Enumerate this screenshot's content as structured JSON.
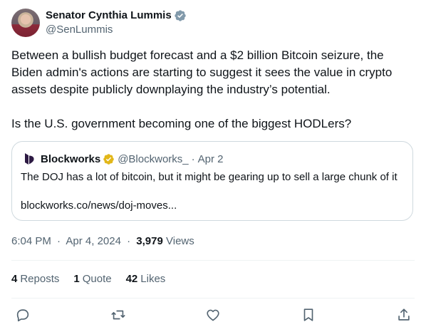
{
  "author": {
    "display_name": "Senator Cynthia Lummis",
    "handle": "@SenLummis",
    "verified_color": "#829aab"
  },
  "tweet": {
    "text": "Between a bullish budget forecast and a $2 billion Bitcoin seizure, the Biden admin's actions are starting to suggest it sees the value in crypto assets despite publicly downplaying the industry’s potential.\n\nIs the U.S. government becoming one of the biggest HODLers?"
  },
  "quote": {
    "name": "Blockworks",
    "handle": "@Blockworks_",
    "separator": "·",
    "date": "Apr 2",
    "text": "The DOJ has a lot of bitcoin, but it might be gearing up to sell a large chunk of it",
    "link": "blockworks.co/news/doj-moves...",
    "badge_color": "#e2b719",
    "logo_color": "#2d1a43"
  },
  "meta": {
    "time": "6:04 PM",
    "dot1": "·",
    "date": "Apr 4, 2024",
    "dot2": "·",
    "views_count": "3,979",
    "views_label": "Views"
  },
  "stats": {
    "reposts_count": "4",
    "reposts_label": "Reposts",
    "quotes_count": "1",
    "quotes_label": "Quote",
    "likes_count": "42",
    "likes_label": "Likes"
  },
  "actions": [
    "reply-icon",
    "repost-icon",
    "like-icon",
    "bookmark-icon",
    "share-icon"
  ],
  "colors": {
    "text": "#0f1419",
    "secondary": "#536471",
    "border": "#cfd9de",
    "icon": "#536471"
  }
}
